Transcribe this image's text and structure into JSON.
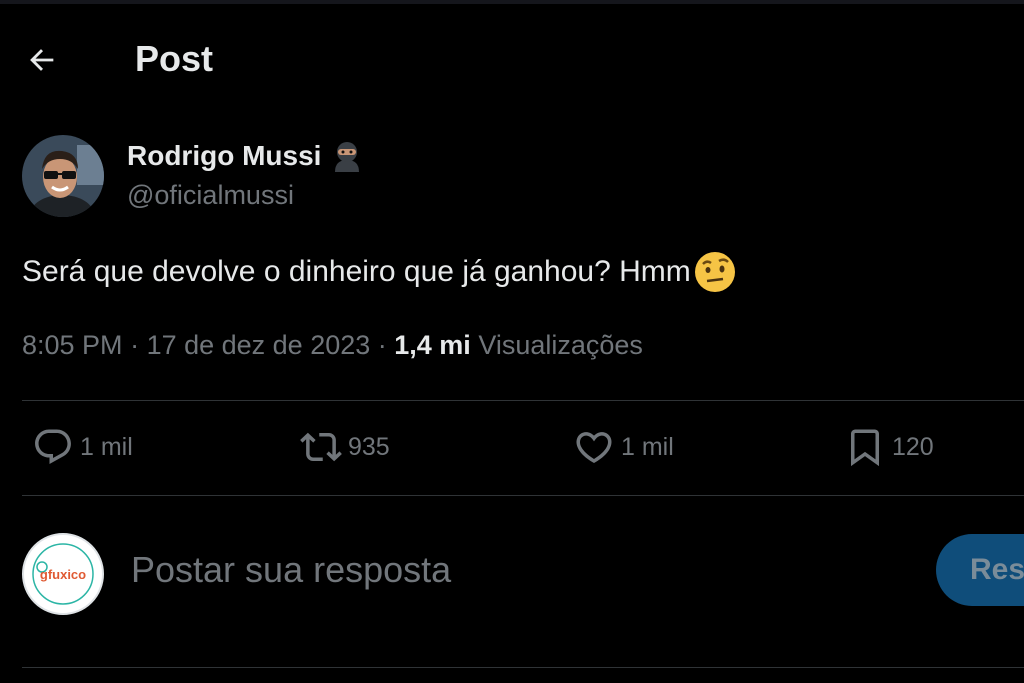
{
  "header": {
    "title": "Post"
  },
  "author": {
    "name": "Rodrigo Mussi",
    "handle": "@oficialmussi"
  },
  "tweet": {
    "text": "Será que devolve o dinheiro que já ganhou? Hmm"
  },
  "meta": {
    "time": "8:05 PM",
    "sep1": " · ",
    "date": "17 de dez de 2023",
    "sep2": " · ",
    "views_count": "1,4 mi",
    "views_label": " Visualizações"
  },
  "actions": {
    "replies": "1 mil",
    "reposts": "935",
    "likes": "1 mil",
    "bookmarks": "120"
  },
  "reply": {
    "placeholder": "Postar sua resposta",
    "button_label": "Res",
    "avatar_text": "gfuxico"
  },
  "colors": {
    "background": "#000000",
    "text": "#e7e9ea",
    "muted": "#71767b",
    "divider": "#2f3336",
    "button": "#0f4d7a"
  }
}
